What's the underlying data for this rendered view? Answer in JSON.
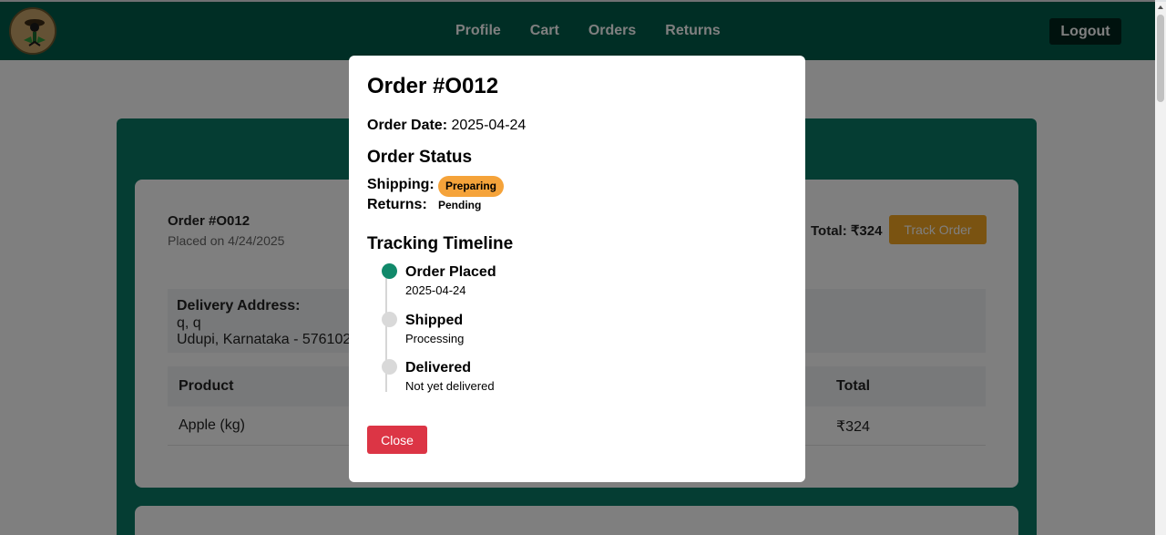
{
  "nav": {
    "links": [
      "Profile",
      "Cart",
      "Orders",
      "Returns"
    ],
    "logout": "Logout",
    "color": "#005c4b"
  },
  "order_card": {
    "title": "Order #O012",
    "placed": "Placed on 4/24/2025",
    "total": "Total: ₹324",
    "track_button": "Track Order",
    "address_label": "Delivery Address:",
    "address_line1": "q, q",
    "address_line2": "Udupi, Karnataka - 576102",
    "table_headers": {
      "product": "Product",
      "total": "Total"
    },
    "rows": [
      {
        "product": "Apple (kg)",
        "total": "₹324"
      }
    ]
  },
  "modal": {
    "title": "Order #O012",
    "date_label": "Order Date:",
    "date_value": "2025-04-24",
    "status_heading": "Order Status",
    "shipping_label": "Shipping:",
    "shipping_status": "Preparing",
    "returns_label": "Returns:",
    "returns_status": "Pending",
    "timeline_heading": "Tracking Timeline",
    "timeline": [
      {
        "title": "Order Placed",
        "sub": "2025-04-24",
        "done": true
      },
      {
        "title": "Shipped",
        "sub": "Processing",
        "done": false
      },
      {
        "title": "Delivered",
        "sub": "Not yet delivered",
        "done": false
      }
    ],
    "close_button": "Close",
    "accent_colors": {
      "done": "#11896a",
      "preparing": "#f5a33a",
      "close": "#dc3545"
    }
  }
}
